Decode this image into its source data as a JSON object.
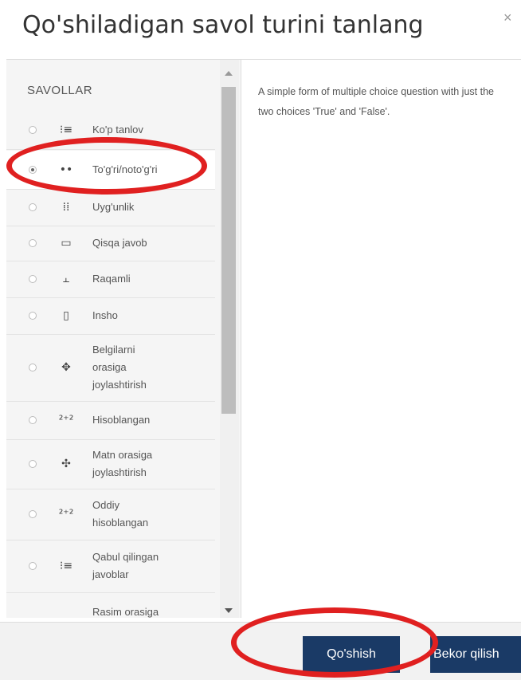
{
  "dialog": {
    "title": "Qo'shiladigan savol turini tanlang",
    "close_glyph": "×"
  },
  "list": {
    "heading": "SAVOLLAR",
    "items": [
      {
        "label": "Ko'p tanlov",
        "icon": "multichoice-icon",
        "glyph": "⁝≡",
        "selected": false
      },
      {
        "label": "To'g'ri/noto'g'ri",
        "icon": "truefalse-icon",
        "glyph": "••",
        "selected": true
      },
      {
        "label": "Uyg'unlik",
        "icon": "matching-icon",
        "glyph": "⁞⁞",
        "selected": false
      },
      {
        "label": "Qisqa javob",
        "icon": "short-answer-icon",
        "glyph": "▭",
        "selected": false
      },
      {
        "label": "Raqamli",
        "icon": "numerical-icon",
        "glyph": "⫠",
        "selected": false
      },
      {
        "label": "Insho",
        "icon": "essay-icon",
        "glyph": "▯",
        "selected": false
      },
      {
        "label": "Belgilarni orasiga joylashtirish",
        "icon": "drag-markers-icon",
        "glyph": "✥",
        "selected": false
      },
      {
        "label": "Hisoblangan",
        "icon": "calculated-icon",
        "glyph": "²⁺²",
        "selected": false
      },
      {
        "label": "Matn orasiga joylashtirish",
        "icon": "drag-text-icon",
        "glyph": "✣",
        "selected": false
      },
      {
        "label": "Oddiy hisoblangan",
        "icon": "calculated-simple-icon",
        "glyph": "²⁺²",
        "selected": false
      },
      {
        "label": "Qabul qilingan javoblar",
        "icon": "calculated-multi-icon",
        "glyph": "⁝≡",
        "selected": false
      },
      {
        "label": "Rasim orasiga",
        "icon": "drag-image-icon",
        "glyph": "▦",
        "selected": false
      }
    ]
  },
  "description": "A simple form of multiple choice question with just the two choices 'True' and 'False'.",
  "buttons": {
    "add": "Qo'shish",
    "cancel": "Bekor qilish"
  },
  "colors": {
    "primary_button": "#1a3a66",
    "annotation_red": "#e02020"
  }
}
